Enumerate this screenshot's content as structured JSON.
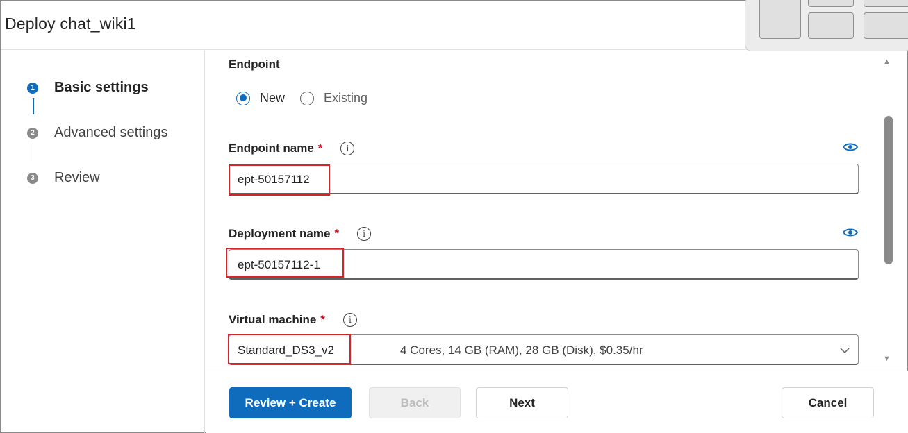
{
  "header": {
    "title": "Deploy chat_wiki1"
  },
  "steps": [
    {
      "number": "1",
      "label": "Basic settings",
      "active": true
    },
    {
      "number": "2",
      "label": "Advanced settings",
      "active": false
    },
    {
      "number": "3",
      "label": "Review",
      "active": false
    }
  ],
  "endpoint": {
    "heading": "Endpoint",
    "options": [
      {
        "label": "New",
        "checked": true
      },
      {
        "label": "Existing",
        "checked": false
      }
    ]
  },
  "fields": {
    "endpoint_name": {
      "label": "Endpoint name",
      "required_mark": "*",
      "value": "ept-50157112",
      "info": "i"
    },
    "deployment_name": {
      "label": "Deployment name",
      "required_mark": "*",
      "value": "ept-50157112-1",
      "info": "i"
    },
    "virtual_machine": {
      "label": "Virtual machine",
      "required_mark": "*",
      "value": "Standard_DS3_v2",
      "description": "4 Cores, 14 GB (RAM), 28 GB (Disk), $0.35/hr",
      "info": "i"
    }
  },
  "footer": {
    "review_create": "Review + Create",
    "back": "Back",
    "next": "Next",
    "cancel": "Cancel"
  },
  "colors": {
    "accent": "#0f6cbd",
    "required": "#c50f1f",
    "highlight": "#d8232a"
  },
  "icons": {
    "info": "info-icon",
    "eye": "eye-icon",
    "chevron": "chevron-down-icon"
  }
}
